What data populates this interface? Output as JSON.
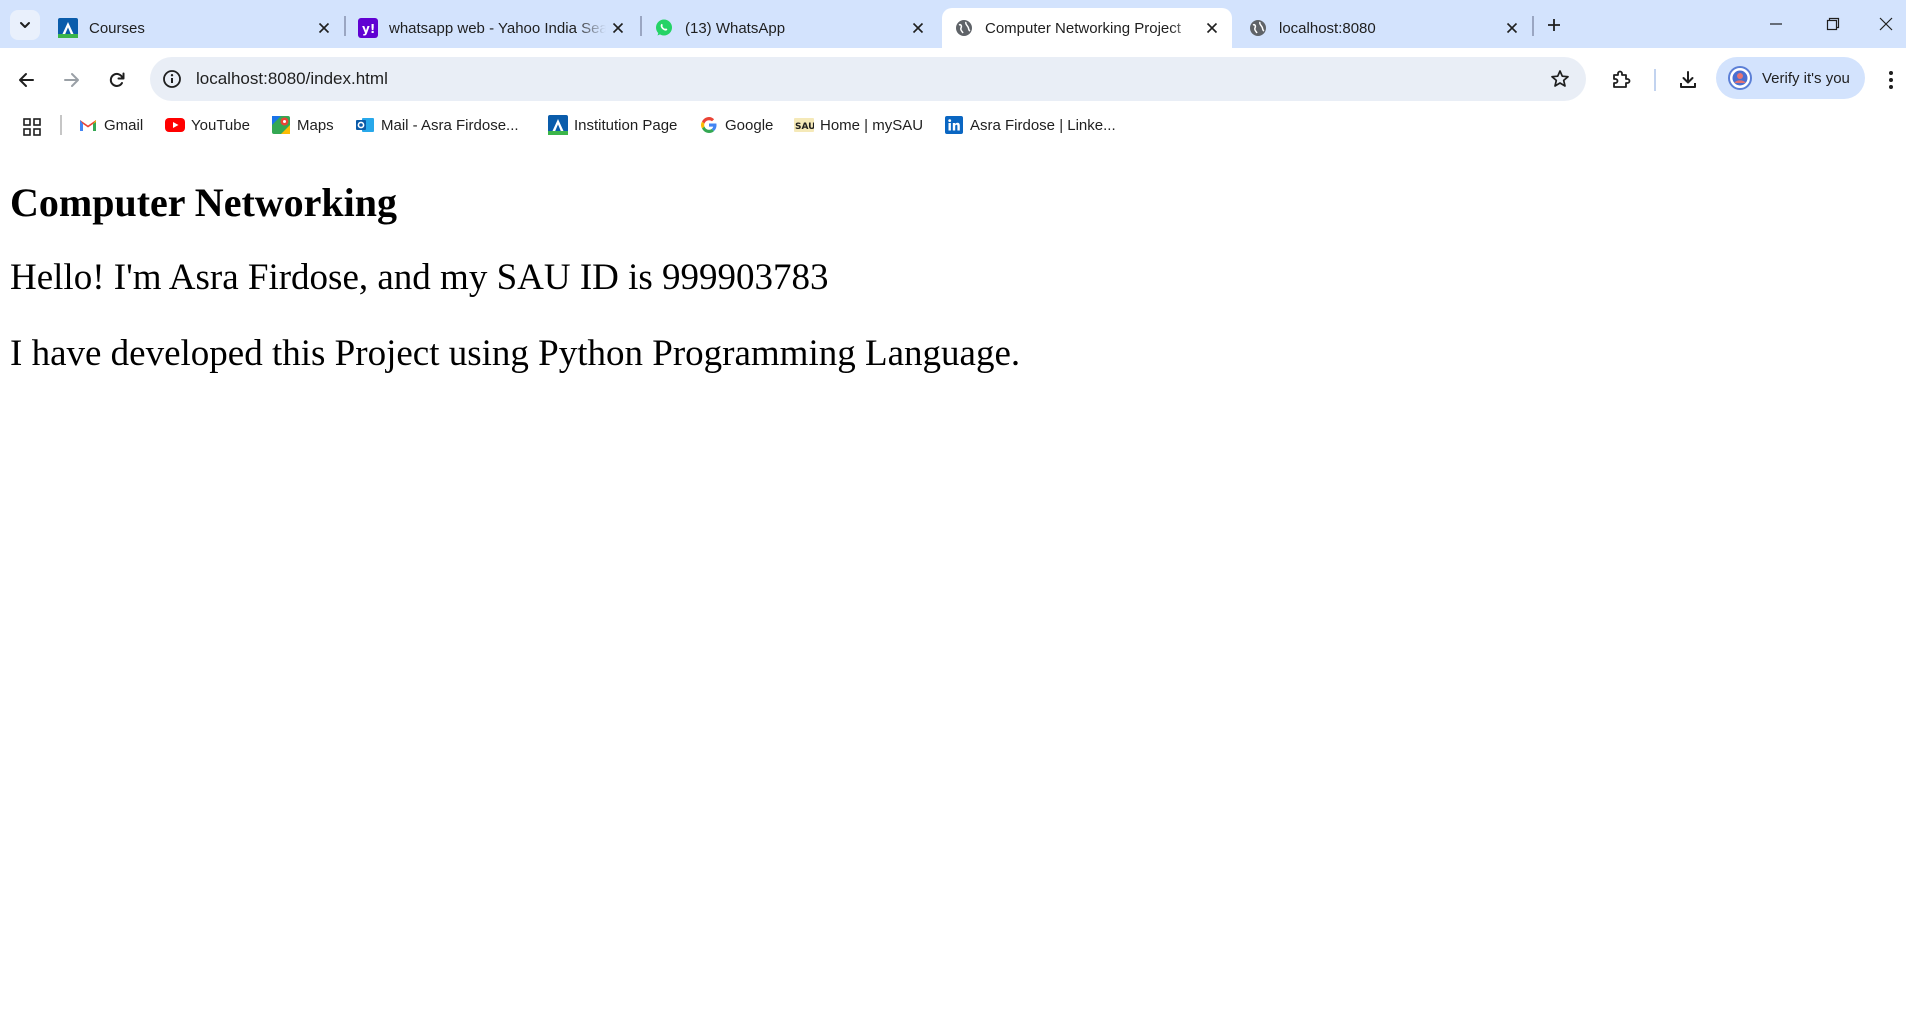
{
  "window": {
    "tabs": [
      {
        "title": "Courses",
        "favicon": "canvas-logo-icon",
        "active": false
      },
      {
        "title": "whatsapp web - Yahoo India Search Results",
        "favicon": "yahoo-logo-icon",
        "active": false
      },
      {
        "title": "(13) WhatsApp",
        "favicon": "whatsapp-logo-icon",
        "active": false
      },
      {
        "title": "Computer Networking Project",
        "favicon": "globe-icon",
        "active": true
      },
      {
        "title": "localhost:8080",
        "favicon": "globe-icon",
        "active": false
      }
    ]
  },
  "toolbar": {
    "url": "localhost:8080/index.html",
    "verify_label": "Verify it's you"
  },
  "bookmarks": [
    {
      "label": "Gmail",
      "icon": "gmail-icon"
    },
    {
      "label": "YouTube",
      "icon": "youtube-icon"
    },
    {
      "label": "Maps",
      "icon": "maps-icon"
    },
    {
      "label": "Mail - Asra Firdose...",
      "icon": "outlook-icon"
    },
    {
      "label": "Institution Page",
      "icon": "canvas-logo-icon"
    },
    {
      "label": "Google",
      "icon": "google-icon"
    },
    {
      "label": "Home | mySAU",
      "icon": "sau-logo-icon"
    },
    {
      "label": "Asra Firdose | Linke...",
      "icon": "linkedin-icon"
    }
  ],
  "page": {
    "heading": "Computer Networking",
    "intro": "Hello! I'm Asra Firdose, and my SAU ID is 999903783",
    "description": "I have developed this Project using Python Programming Language."
  },
  "colors": {
    "tabstrip_bg": "#d3e3fd",
    "omnibox_bg": "#e9eef6",
    "verify_chip_bg": "#d3e3fd"
  }
}
